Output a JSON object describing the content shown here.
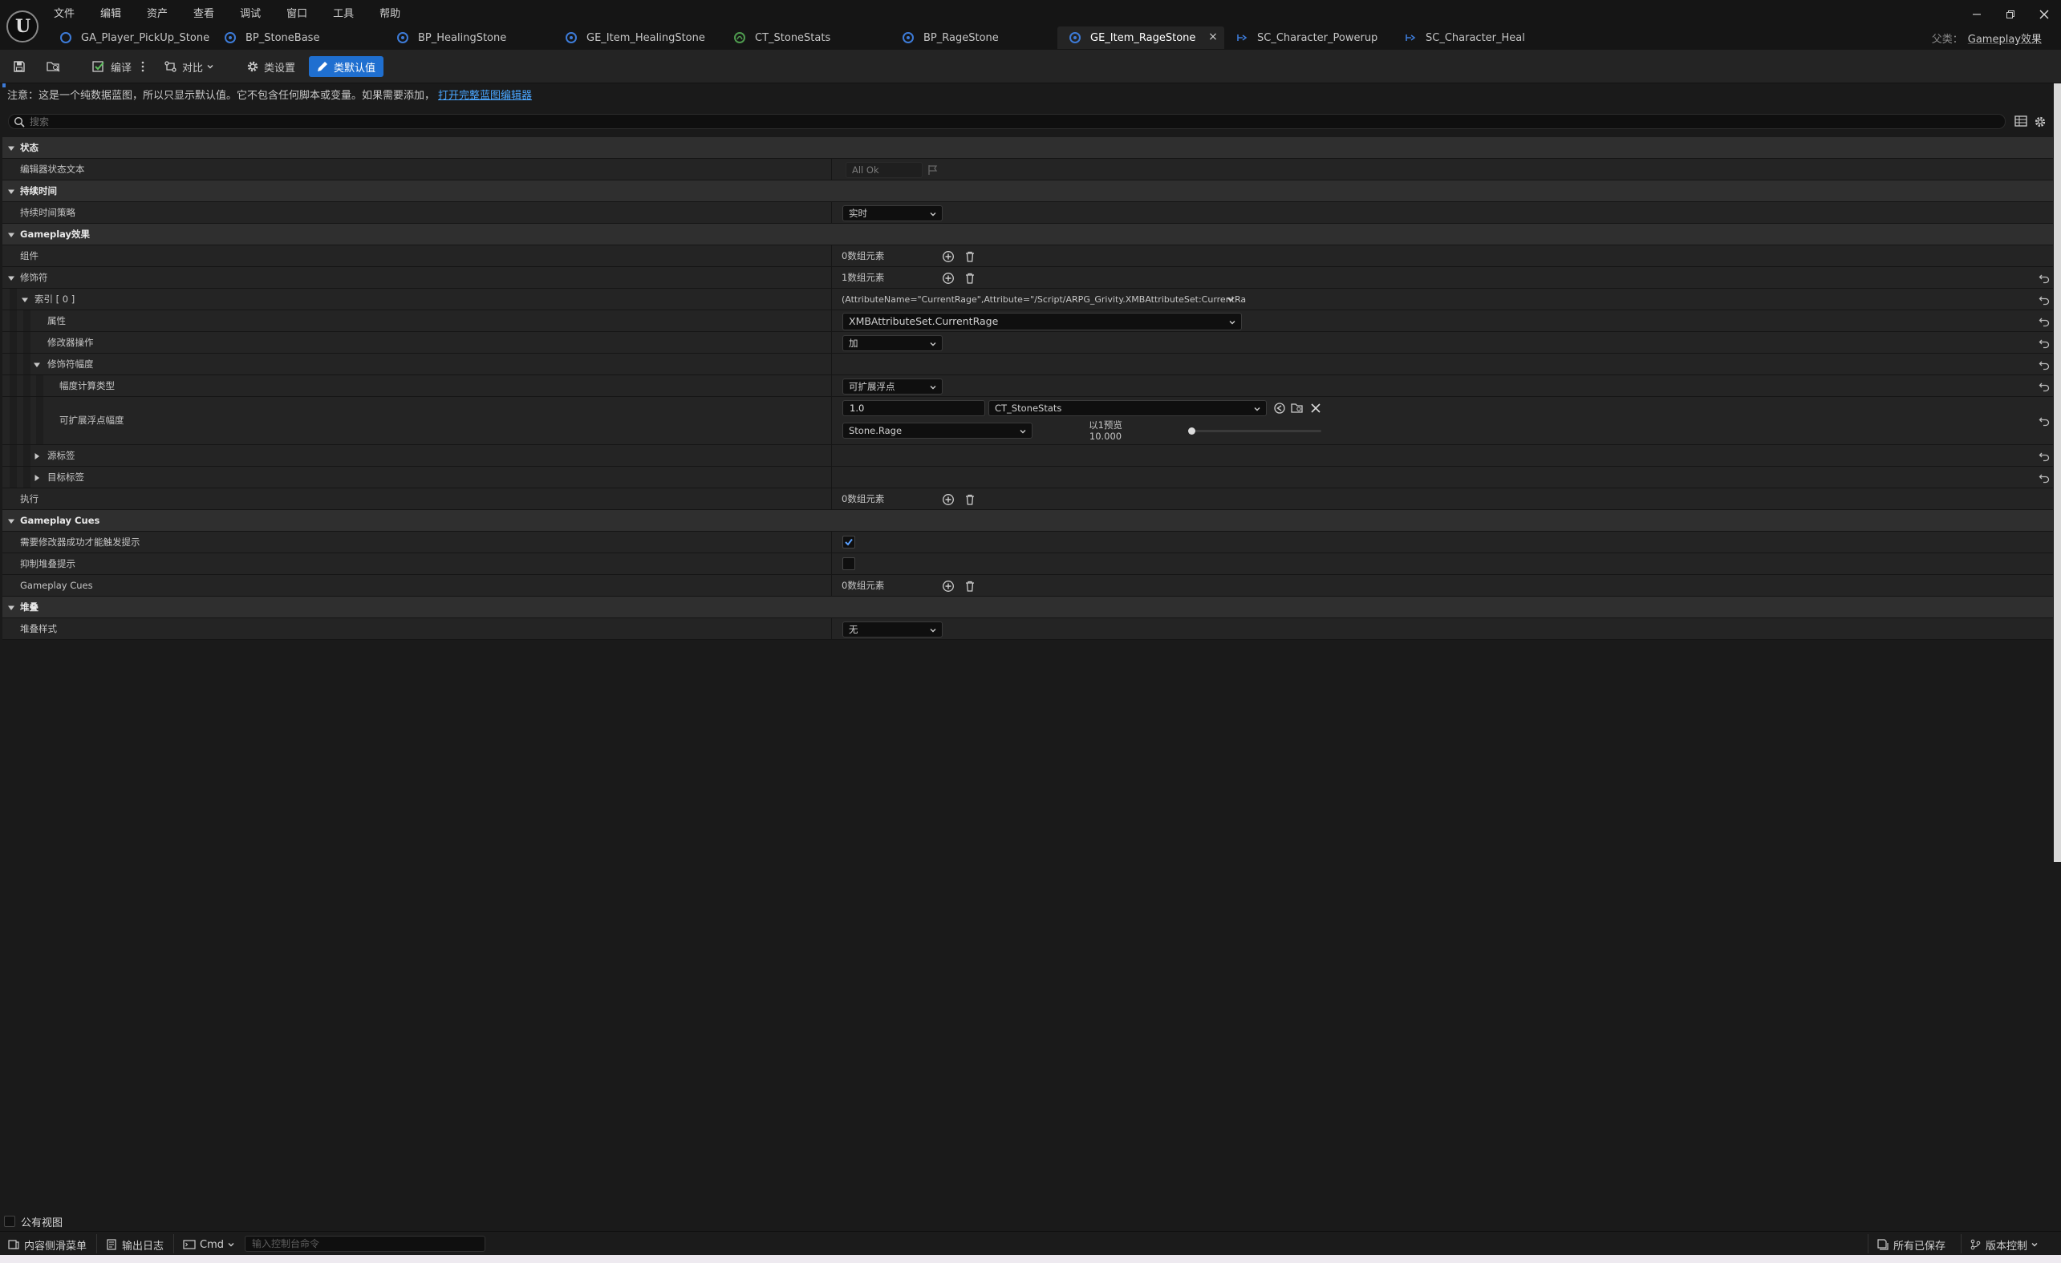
{
  "menu": [
    "文件",
    "编辑",
    "资产",
    "查看",
    "调试",
    "窗口",
    "工具",
    "帮助"
  ],
  "tabs": [
    {
      "label": "GA_Player_PickUp_Stone",
      "icon": "gameplay-ability-icon",
      "active": false
    },
    {
      "label": "BP_StoneBase",
      "icon": "blueprint-icon",
      "active": false
    },
    {
      "label": "BP_HealingStone",
      "icon": "blueprint-icon",
      "active": false
    },
    {
      "label": "GE_Item_HealingStone",
      "icon": "gameplay-effect-icon",
      "active": false
    },
    {
      "label": "CT_StoneStats",
      "icon": "curve-table-icon",
      "active": false
    },
    {
      "label": "BP_RageStone",
      "icon": "blueprint-icon",
      "active": false
    },
    {
      "label": "GE_Item_RageStone",
      "icon": "gameplay-effect-icon",
      "active": true
    },
    {
      "label": "SC_Character_Powerup",
      "icon": "state-tree-icon",
      "active": false
    },
    {
      "label": "SC_Character_Heal",
      "icon": "state-tree-icon",
      "active": false
    }
  ],
  "parent_class": {
    "label": "父类：",
    "value": "Gameplay效果"
  },
  "toolbar": {
    "compile": "编译",
    "diff": "对比",
    "class_settings": "类设置",
    "class_defaults": "类默认值"
  },
  "notice": {
    "text": "注意：这是一个纯数据蓝图，所以只显示默认值。它不包含任何脚本或变量。如果需要添加，",
    "link": "打开完整蓝图编辑器"
  },
  "search": {
    "placeholder": "搜索"
  },
  "details": {
    "cat_status": "状态",
    "editor_status_text": "编辑器状态文本",
    "editor_status_value": "All Ok",
    "cat_duration": "持续时间",
    "duration_policy": "持续时间策略",
    "duration_policy_value": "实时",
    "cat_gameplay_effect": "Gameplay效果",
    "components": "组件",
    "components_value": "0数组元素",
    "modifiers": "修饰符",
    "modifiers_value": "1数组元素",
    "index0": "索引 [ 0 ]",
    "index0_value": "(AttributeName=\"CurrentRage\",Attribute=\"/Script/ARPG_Grivity.XMBAttributeSet:CurrentRa",
    "attribute": "属性",
    "attribute_value": "XMBAttributeSet.CurrentRage",
    "modifier_op": "修改器操作",
    "modifier_op_value": "加",
    "modifier_magnitude": "修饰符幅度",
    "magnitude_calc_type": "幅度计算类型",
    "magnitude_calc_type_value": "可扩展浮点",
    "scalable_float_magnitude": "可扩展浮点幅度",
    "scalable_value": "1.0",
    "curve_table": "CT_StoneStats",
    "curve_row": "Stone.Rage",
    "preview_label": "以1预览",
    "preview_value": "10.000",
    "preview_slider_fraction": 0,
    "source_tags": "源标签",
    "target_tags": "目标标签",
    "executions": "执行",
    "executions_value": "0数组元素",
    "cat_gameplay_cues": "Gameplay Cues",
    "require_modifier_success": "需要修改器成功才能触发提示",
    "require_modifier_success_checked": true,
    "suppress_stacking_cues": "抑制堆叠提示",
    "suppress_stacking_cues_checked": false,
    "gameplay_cues": "Gameplay Cues",
    "gameplay_cues_value": "0数组元素",
    "cat_stacking": "堆叠",
    "stacking_type": "堆叠样式",
    "stacking_type_value": "无"
  },
  "bottom": {
    "public_view": "公有视图",
    "content_drawer": "内容侧滑菜单",
    "output_log": "输出日志",
    "cmd": "Cmd",
    "cmd_placeholder": "输入控制台命令",
    "all_saved": "所有已保存",
    "source_control": "版本控制"
  },
  "colors": {
    "accent_blue": "#1f6fd0",
    "link_blue": "#4aa6ff",
    "panel_bg": "#242424",
    "category_bg": "#2f2f2f"
  }
}
